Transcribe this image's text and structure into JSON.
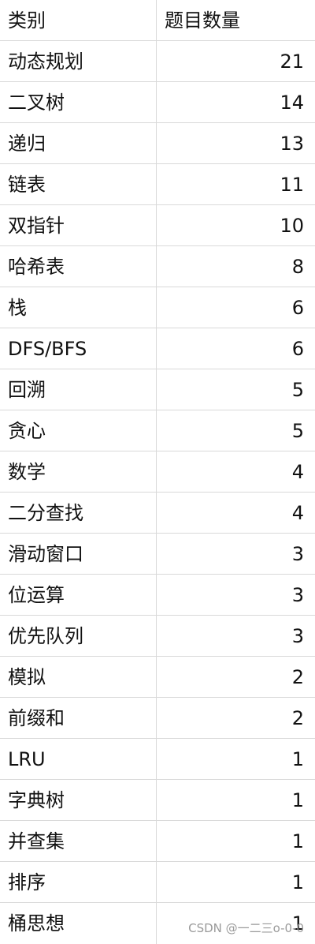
{
  "table": {
    "headers": {
      "category": "类别",
      "count": "题目数量"
    },
    "rows": [
      {
        "category": "动态规划",
        "count": "21"
      },
      {
        "category": "二叉树",
        "count": "14"
      },
      {
        "category": "递归",
        "count": "13"
      },
      {
        "category": "链表",
        "count": "11"
      },
      {
        "category": "双指针",
        "count": "10"
      },
      {
        "category": "哈希表",
        "count": "8"
      },
      {
        "category": "栈",
        "count": "6"
      },
      {
        "category": "DFS/BFS",
        "count": "6"
      },
      {
        "category": "回溯",
        "count": "5"
      },
      {
        "category": "贪心",
        "count": "5"
      },
      {
        "category": "数学",
        "count": "4"
      },
      {
        "category": "二分查找",
        "count": "4"
      },
      {
        "category": "滑动窗口",
        "count": "3"
      },
      {
        "category": "位运算",
        "count": "3"
      },
      {
        "category": "优先队列",
        "count": "3"
      },
      {
        "category": "模拟",
        "count": "2"
      },
      {
        "category": "前缀和",
        "count": "2"
      },
      {
        "category": "LRU",
        "count": "1"
      },
      {
        "category": "字典树",
        "count": "1"
      },
      {
        "category": "并查集",
        "count": "1"
      },
      {
        "category": "排序",
        "count": "1"
      },
      {
        "category": "桶思想",
        "count": "1"
      }
    ]
  },
  "watermark": "CSDN @一二三o-0-0"
}
